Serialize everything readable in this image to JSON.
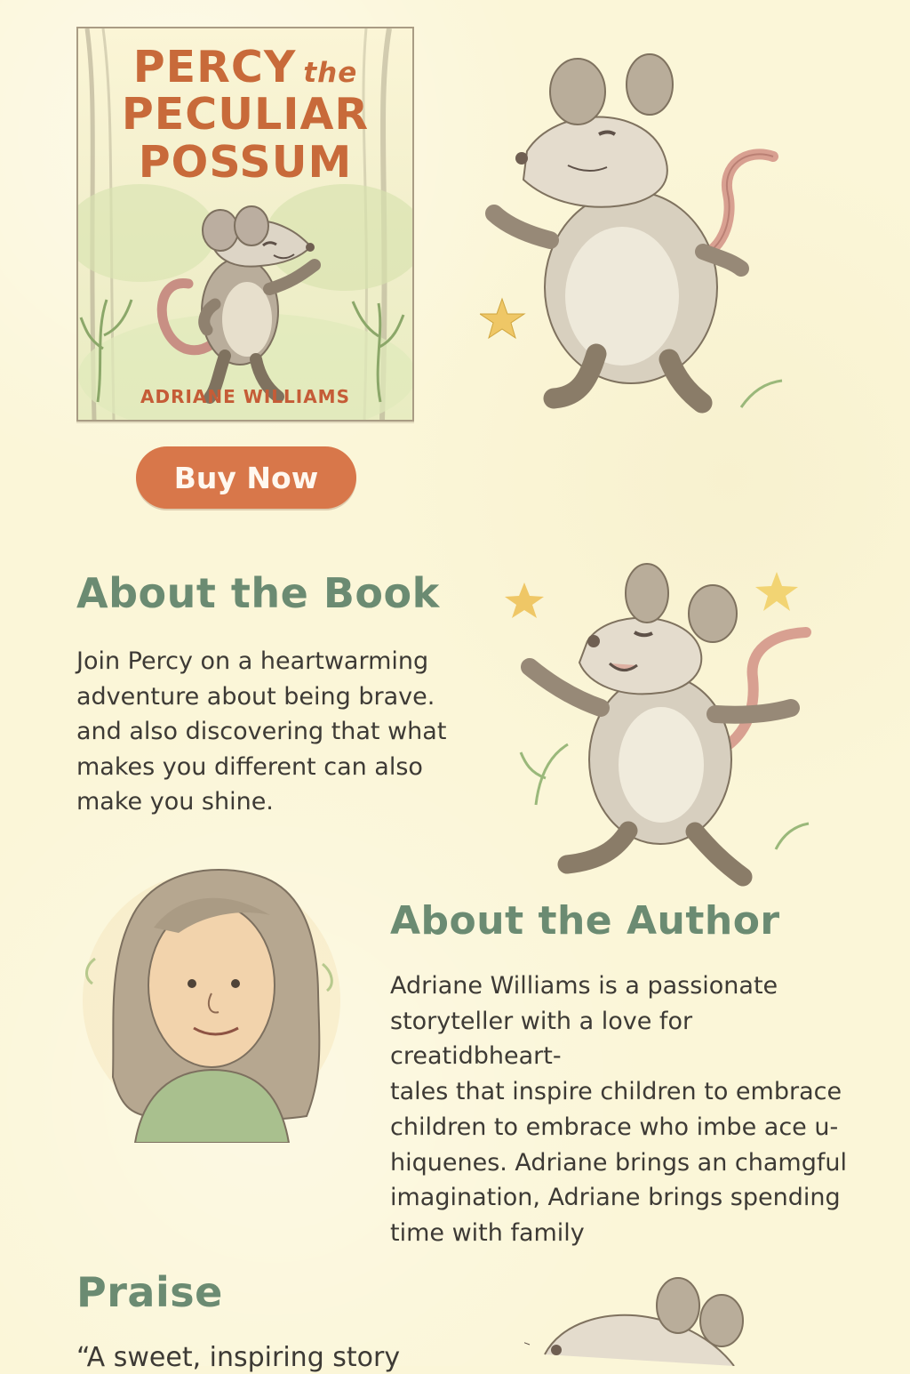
{
  "cover": {
    "title_line1": "Percy",
    "title_the": "the",
    "title_line2": "Peculiar",
    "title_line3": "Possum",
    "author": "ADRIANE WILLIAMS"
  },
  "buttons": {
    "buy_now": "Buy Now"
  },
  "about_book": {
    "title": "About the Book",
    "text": "Join Percy on a heartwarming\nadventure about being brave.\nand also discovering that what\nmakes you different can also\nmake you shine."
  },
  "about_author": {
    "title": "About the Author",
    "text": "Adriane Williams is a passionate\nstoryteller with a love for creatidbheart-\ntales that inspire children to embrace\nchildren to embrace who imbe ace u-\nhiquenes. Adriane brings an chamgful\nimagination, Adriane brings spending\ntime with family"
  },
  "praise": {
    "title": "Praise",
    "quote": "“A sweet, inspiring story"
  },
  "icons": {
    "cover_possum": "possum-illustration-icon",
    "hero_possum": "possum-illustration-icon",
    "dancing_possum": "possum-illustration-icon",
    "author_portrait": "author-portrait-icon",
    "praise_possum": "possum-illustration-icon",
    "star": "star-icon",
    "plant": "plant-icon"
  },
  "colors": {
    "background": "#fbf6d8",
    "accent_orange": "#d8774a",
    "heading_green": "#6b8b72",
    "body_text": "#3d3a35"
  }
}
